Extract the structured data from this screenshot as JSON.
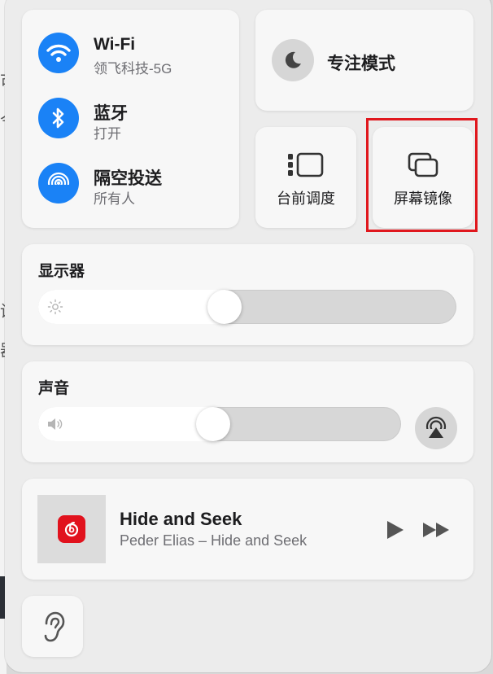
{
  "network": {
    "wifi": {
      "title": "Wi-Fi",
      "subtitle": "领飞科技-5G"
    },
    "bluetooth": {
      "title": "蓝牙",
      "subtitle": "打开"
    },
    "airdrop": {
      "title": "隔空投送",
      "subtitle": "所有人"
    }
  },
  "focus": {
    "label": "专注模式"
  },
  "stage_manager": {
    "label": "台前调度"
  },
  "screen_mirroring": {
    "label": "屏幕镜像"
  },
  "display": {
    "title": "显示器",
    "brightness": 0.44
  },
  "sound": {
    "title": "声音",
    "volume": 0.48
  },
  "now_playing": {
    "title": "Hide and Seek",
    "artist": "Peder Elias – Hide and Seek"
  },
  "icons": {
    "wifi": "wifi-icon",
    "bluetooth": "bluetooth-icon",
    "airdrop": "airdrop-icon",
    "focus": "moon-icon",
    "stage_manager": "stage-manager-icon",
    "screen_mirroring": "screen-mirroring-icon",
    "brightness": "sun-icon",
    "volume": "speaker-icon",
    "airplay": "airplay-icon",
    "album": "netease-music-icon",
    "play": "play-icon",
    "forward": "fast-forward-icon",
    "hearing": "ear-icon"
  },
  "colors": {
    "accent": "#1a82f6",
    "highlight": "#e0171d",
    "music_app": "#e1121d"
  }
}
